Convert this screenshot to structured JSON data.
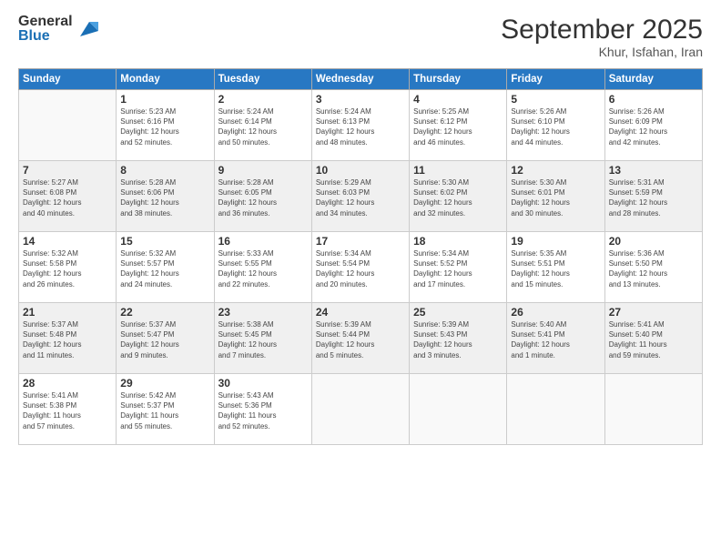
{
  "logo": {
    "general": "General",
    "blue": "Blue"
  },
  "header": {
    "month": "September 2025",
    "location": "Khur, Isfahan, Iran"
  },
  "weekdays": [
    "Sunday",
    "Monday",
    "Tuesday",
    "Wednesday",
    "Thursday",
    "Friday",
    "Saturday"
  ],
  "weeks": [
    [
      {
        "day": "",
        "info": ""
      },
      {
        "day": "1",
        "info": "Sunrise: 5:23 AM\nSunset: 6:16 PM\nDaylight: 12 hours\nand 52 minutes."
      },
      {
        "day": "2",
        "info": "Sunrise: 5:24 AM\nSunset: 6:14 PM\nDaylight: 12 hours\nand 50 minutes."
      },
      {
        "day": "3",
        "info": "Sunrise: 5:24 AM\nSunset: 6:13 PM\nDaylight: 12 hours\nand 48 minutes."
      },
      {
        "day": "4",
        "info": "Sunrise: 5:25 AM\nSunset: 6:12 PM\nDaylight: 12 hours\nand 46 minutes."
      },
      {
        "day": "5",
        "info": "Sunrise: 5:26 AM\nSunset: 6:10 PM\nDaylight: 12 hours\nand 44 minutes."
      },
      {
        "day": "6",
        "info": "Sunrise: 5:26 AM\nSunset: 6:09 PM\nDaylight: 12 hours\nand 42 minutes."
      }
    ],
    [
      {
        "day": "7",
        "info": "Sunrise: 5:27 AM\nSunset: 6:08 PM\nDaylight: 12 hours\nand 40 minutes."
      },
      {
        "day": "8",
        "info": "Sunrise: 5:28 AM\nSunset: 6:06 PM\nDaylight: 12 hours\nand 38 minutes."
      },
      {
        "day": "9",
        "info": "Sunrise: 5:28 AM\nSunset: 6:05 PM\nDaylight: 12 hours\nand 36 minutes."
      },
      {
        "day": "10",
        "info": "Sunrise: 5:29 AM\nSunset: 6:03 PM\nDaylight: 12 hours\nand 34 minutes."
      },
      {
        "day": "11",
        "info": "Sunrise: 5:30 AM\nSunset: 6:02 PM\nDaylight: 12 hours\nand 32 minutes."
      },
      {
        "day": "12",
        "info": "Sunrise: 5:30 AM\nSunset: 6:01 PM\nDaylight: 12 hours\nand 30 minutes."
      },
      {
        "day": "13",
        "info": "Sunrise: 5:31 AM\nSunset: 5:59 PM\nDaylight: 12 hours\nand 28 minutes."
      }
    ],
    [
      {
        "day": "14",
        "info": "Sunrise: 5:32 AM\nSunset: 5:58 PM\nDaylight: 12 hours\nand 26 minutes."
      },
      {
        "day": "15",
        "info": "Sunrise: 5:32 AM\nSunset: 5:57 PM\nDaylight: 12 hours\nand 24 minutes."
      },
      {
        "day": "16",
        "info": "Sunrise: 5:33 AM\nSunset: 5:55 PM\nDaylight: 12 hours\nand 22 minutes."
      },
      {
        "day": "17",
        "info": "Sunrise: 5:34 AM\nSunset: 5:54 PM\nDaylight: 12 hours\nand 20 minutes."
      },
      {
        "day": "18",
        "info": "Sunrise: 5:34 AM\nSunset: 5:52 PM\nDaylight: 12 hours\nand 17 minutes."
      },
      {
        "day": "19",
        "info": "Sunrise: 5:35 AM\nSunset: 5:51 PM\nDaylight: 12 hours\nand 15 minutes."
      },
      {
        "day": "20",
        "info": "Sunrise: 5:36 AM\nSunset: 5:50 PM\nDaylight: 12 hours\nand 13 minutes."
      }
    ],
    [
      {
        "day": "21",
        "info": "Sunrise: 5:37 AM\nSunset: 5:48 PM\nDaylight: 12 hours\nand 11 minutes."
      },
      {
        "day": "22",
        "info": "Sunrise: 5:37 AM\nSunset: 5:47 PM\nDaylight: 12 hours\nand 9 minutes."
      },
      {
        "day": "23",
        "info": "Sunrise: 5:38 AM\nSunset: 5:45 PM\nDaylight: 12 hours\nand 7 minutes."
      },
      {
        "day": "24",
        "info": "Sunrise: 5:39 AM\nSunset: 5:44 PM\nDaylight: 12 hours\nand 5 minutes."
      },
      {
        "day": "25",
        "info": "Sunrise: 5:39 AM\nSunset: 5:43 PM\nDaylight: 12 hours\nand 3 minutes."
      },
      {
        "day": "26",
        "info": "Sunrise: 5:40 AM\nSunset: 5:41 PM\nDaylight: 12 hours\nand 1 minute."
      },
      {
        "day": "27",
        "info": "Sunrise: 5:41 AM\nSunset: 5:40 PM\nDaylight: 11 hours\nand 59 minutes."
      }
    ],
    [
      {
        "day": "28",
        "info": "Sunrise: 5:41 AM\nSunset: 5:38 PM\nDaylight: 11 hours\nand 57 minutes."
      },
      {
        "day": "29",
        "info": "Sunrise: 5:42 AM\nSunset: 5:37 PM\nDaylight: 11 hours\nand 55 minutes."
      },
      {
        "day": "30",
        "info": "Sunrise: 5:43 AM\nSunset: 5:36 PM\nDaylight: 11 hours\nand 52 minutes."
      },
      {
        "day": "",
        "info": ""
      },
      {
        "day": "",
        "info": ""
      },
      {
        "day": "",
        "info": ""
      },
      {
        "day": "",
        "info": ""
      }
    ]
  ]
}
